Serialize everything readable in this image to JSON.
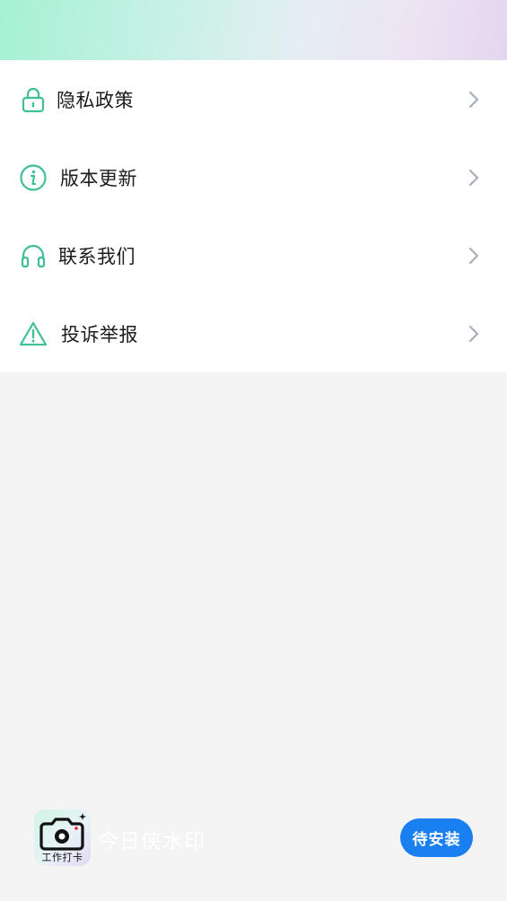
{
  "menu": {
    "items": [
      {
        "label": "隐私政策",
        "icon": "lock-icon"
      },
      {
        "label": "版本更新",
        "icon": "info-icon"
      },
      {
        "label": "联系我们",
        "icon": "headphones-icon"
      },
      {
        "label": "投诉举报",
        "icon": "warning-icon"
      }
    ],
    "icon_color": "#3fbf98",
    "chevron_color": "#a9afb8"
  },
  "ad_banner": {
    "app_name": "今日侠水印",
    "app_icon_caption": "工作打卡",
    "install_label": "待安装",
    "install_color": "#1a7ff0"
  }
}
